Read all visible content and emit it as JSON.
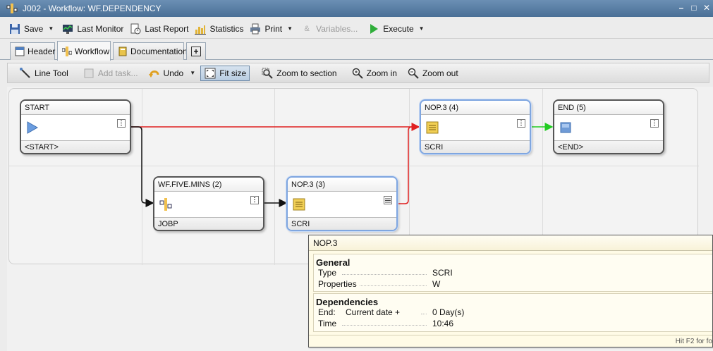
{
  "window": {
    "title": "J002 - Workflow: WF.DEPENDENCY"
  },
  "toolbar": {
    "save": "Save",
    "last_monitor": "Last Monitor",
    "last_report": "Last Report",
    "statistics": "Statistics",
    "print": "Print",
    "variables": "Variables...",
    "execute": "Execute"
  },
  "tabs": [
    {
      "label": "Header"
    },
    {
      "label": "Workflow"
    },
    {
      "label": "Documentation"
    },
    {
      "label": "+"
    }
  ],
  "workflow_toolbar": {
    "line_tool": "Line Tool",
    "add_task": "Add task...",
    "undo": "Undo",
    "fit_size": "Fit size",
    "zoom_to_section": "Zoom to section",
    "zoom_in": "Zoom in",
    "zoom_out": "Zoom out"
  },
  "nodes": {
    "start": {
      "title": "START",
      "type": "<START>"
    },
    "wf_five_mins": {
      "title": "WF.FIVE.MINS (2)",
      "type": "JOBP"
    },
    "nop3_3": {
      "title": "NOP.3 (3)",
      "type": "SCRI"
    },
    "nop3_4": {
      "title": "NOP.3 (4)",
      "type": "SCRI"
    },
    "end": {
      "title": "END (5)",
      "type": "<END>"
    }
  },
  "tooltip": {
    "title": "NOP.3",
    "general": {
      "heading": "General",
      "type_label": "Type",
      "type_value": "SCRI",
      "properties_label": "Properties",
      "properties_value": "W"
    },
    "dependencies": {
      "heading": "Dependencies",
      "end_label": "End:",
      "end_desc": "Current date +",
      "end_value": "0 Day(s)",
      "time_label": "Time",
      "time_value": "10:46"
    },
    "hint": "Hit F2 for fo"
  },
  "colors": {
    "link_red": "#e02020",
    "link_green": "#22cc22",
    "link_black": "#111111",
    "selected_border": "#7fa6e0"
  }
}
